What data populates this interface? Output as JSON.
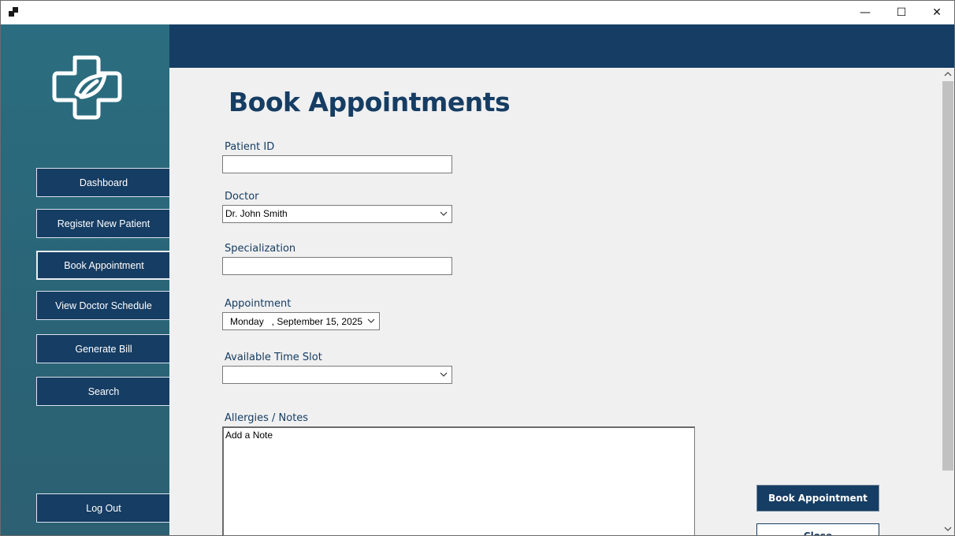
{
  "window": {
    "controls": {
      "minimize": "—",
      "maximize": "☐",
      "close": "✕"
    }
  },
  "sidebar": {
    "logo": "medical-cross-logo",
    "items": [
      {
        "label": "Dashboard"
      },
      {
        "label": "Register New Patient"
      },
      {
        "label": "Book Appointment",
        "active": true
      },
      {
        "label": "View Doctor Schedule"
      },
      {
        "label": "Generate Bill"
      },
      {
        "label": "Search"
      }
    ],
    "logout_label": "Log Out"
  },
  "main": {
    "title": "Book Appointments",
    "patient_id": {
      "label": "Patient ID",
      "value": ""
    },
    "doctor": {
      "label": "Doctor",
      "selected": "Dr. John Smith"
    },
    "specialization": {
      "label": "Specialization",
      "value": ""
    },
    "appointment": {
      "label": "Appointment",
      "date_text": "Monday   , September 15, 2025"
    },
    "time_slot": {
      "label": "Available Time Slot",
      "selected": ""
    },
    "notes": {
      "label": "Allergies / Notes",
      "value": "Add a Note"
    },
    "book_button": "Book Appointment",
    "close_button": "Close"
  },
  "colors": {
    "navy": "#163d63",
    "sidebar_teal": "#2a6476",
    "content_bg": "#f0f0f0"
  }
}
